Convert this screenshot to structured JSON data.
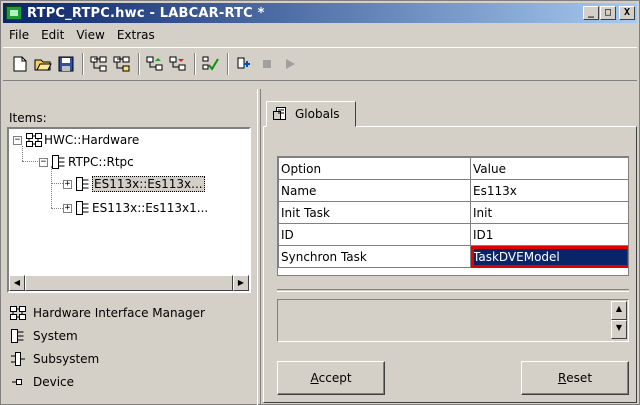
{
  "window": {
    "title": "RTPC_RTPC.hwc - LABCAR-RTC  *",
    "min_glyph": "_",
    "max_glyph": "□",
    "close_glyph": "X"
  },
  "menu": [
    "File",
    "Edit",
    "View",
    "Extras"
  ],
  "toolbar": {
    "icons": [
      "new-file-icon",
      "open-folder-icon",
      "save-icon",
      "hardware-tree-icon",
      "hardware-tree-alt-icon",
      "move-up-icon",
      "move-down-icon",
      "check-icon",
      "connect-icon",
      "stop-icon",
      "run-icon"
    ]
  },
  "left": {
    "items_label": "Items:",
    "tree": [
      {
        "label": "HWC::Hardware",
        "expander": "−"
      },
      {
        "label": "RTPC::Rtpc",
        "expander": "−"
      },
      {
        "label": "ES113x::Es113x...",
        "expander": "+"
      },
      {
        "label": "ES113x::Es113x1...",
        "expander": "+"
      }
    ],
    "legend": [
      {
        "icon": "hwim-icon",
        "label": "Hardware Interface Manager"
      },
      {
        "icon": "system-icon",
        "label": "System"
      },
      {
        "icon": "subsystem-icon",
        "label": "Subsystem"
      },
      {
        "icon": "device-icon",
        "label": "Device"
      }
    ]
  },
  "right": {
    "tab_label": "Globals",
    "grid": {
      "headers": [
        "Option",
        "Value"
      ],
      "rows": [
        [
          "Name",
          "Es113x"
        ],
        [
          "Init Task",
          "Init"
        ],
        [
          "ID",
          "ID1"
        ],
        [
          "Synchron Task",
          "TaskDVEModel"
        ]
      ]
    },
    "accept_prefix": "A",
    "accept_rest": "ccept",
    "reset_prefix": "R",
    "reset_rest": "eset"
  },
  "colors": {
    "title_start": "#0a246a",
    "selection": "#0a246a",
    "highlight_border": "#e00000",
    "face": "#d4d0c8"
  }
}
